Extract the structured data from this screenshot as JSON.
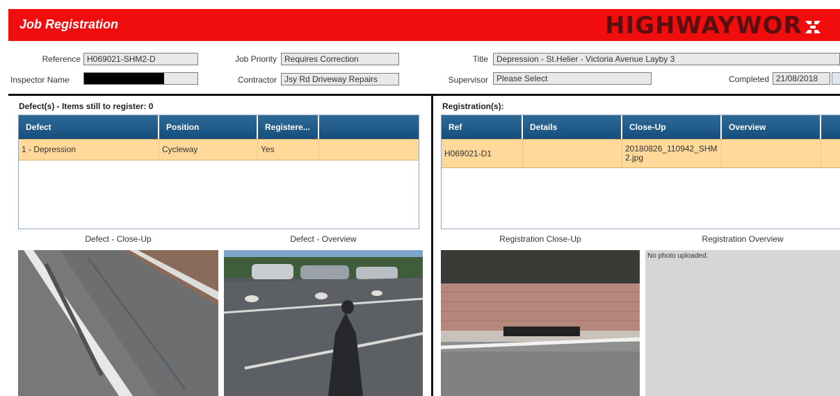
{
  "header": {
    "title": "Job Registration",
    "logo_text": "HIGHWAYWOR"
  },
  "form": {
    "reference_label": "Reference",
    "reference_value": "H069021-SHM2-D",
    "inspector_label": "Inspector Name",
    "inspector_value": "",
    "priority_label": "Job Priority",
    "priority_value": "Requires Correction",
    "contractor_label": "Contractor",
    "contractor_value": "Jsy Rd Driveway Repairs",
    "title_label": "Title",
    "title_value": "Depression - St.Helier - Victoria Avenue Layby 3",
    "supervisor_label": "Supervisor",
    "supervisor_value": "Please Select",
    "completed_label": "Completed",
    "completed_value": "21/08/2018"
  },
  "defects": {
    "heading": "Defect(s) - Items still to register: 0",
    "columns": [
      "Defect",
      "Position",
      "Registere..."
    ],
    "rows": [
      [
        "1 - Depression",
        "Cycleway",
        "Yes"
      ]
    ]
  },
  "registrations": {
    "heading": "Registration(s):",
    "columns": [
      "Ref",
      "Details",
      "Close-Up",
      "Overview"
    ],
    "rows": [
      [
        "H069021-D1",
        "",
        "20180826_110942_SHM2.jpg",
        ""
      ]
    ]
  },
  "captions": {
    "defect_closeup": "Defect - Close-Up",
    "defect_overview": "Defect - Overview",
    "reg_closeup": "Registration Close-Up",
    "reg_overview": "Registration Overview"
  },
  "no_photo_text": "No photo uploaded.",
  "colors": {
    "header_red": "#f10d0d",
    "grid_header": "#1f5b8a",
    "row_highlight": "#ffd99a"
  }
}
